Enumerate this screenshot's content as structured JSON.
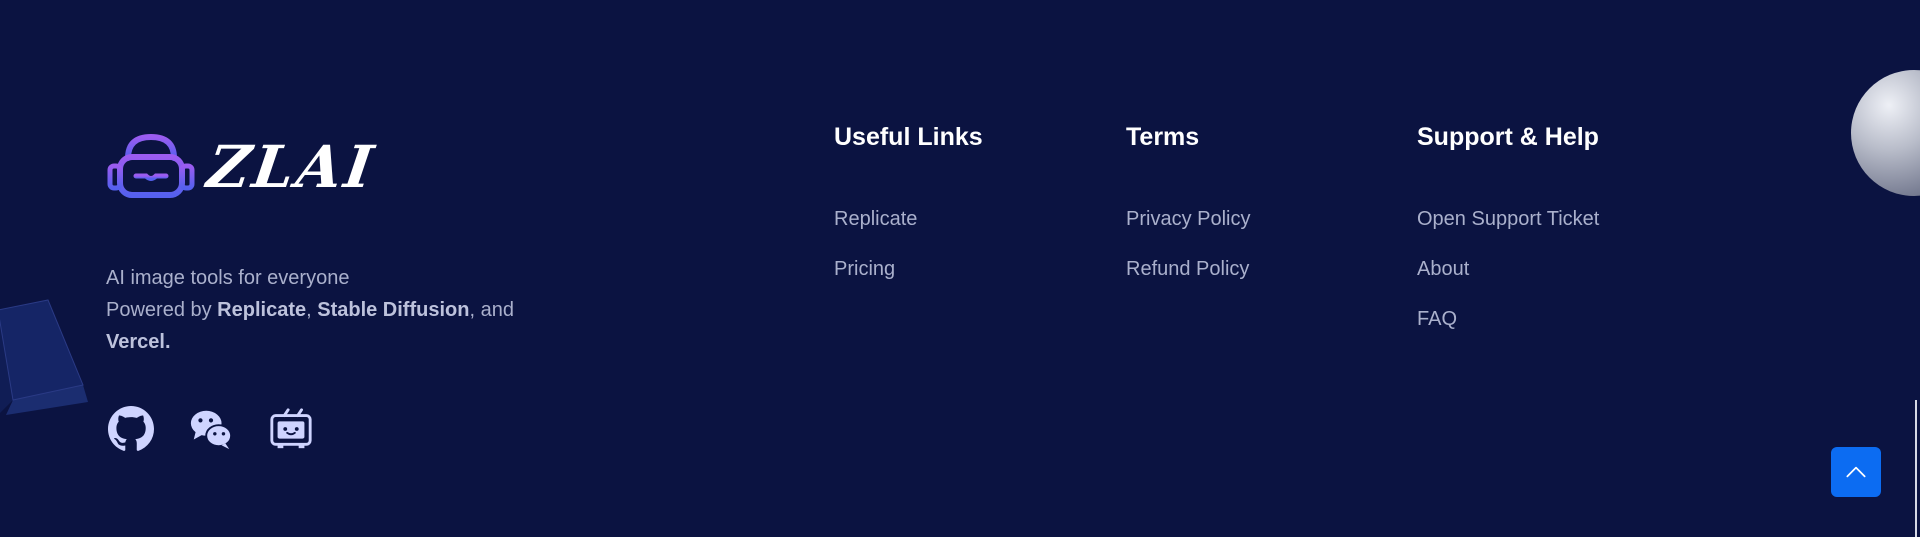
{
  "brand": {
    "name": "ZLAI",
    "tagline_line1": "AI image tools for everyone",
    "powered_prefix": "Powered by ",
    "powered_link1": "Replicate",
    "powered_sep1": ", ",
    "powered_link2": "Stable Diffusion",
    "powered_sep2": ", and ",
    "powered_link3": "Vercel."
  },
  "social": [
    {
      "icon": "github-icon"
    },
    {
      "icon": "wechat-icon"
    },
    {
      "icon": "bilibili-icon"
    }
  ],
  "columns": [
    {
      "title": "Useful Links",
      "links": [
        "Replicate",
        "Pricing"
      ]
    },
    {
      "title": "Terms",
      "links": [
        "Privacy Policy",
        "Refund Policy"
      ]
    },
    {
      "title": "Support & Help",
      "links": [
        "Open Support Ticket",
        "About",
        "FAQ"
      ]
    }
  ],
  "back_to_top": {
    "icon": "chevron-up-icon"
  },
  "colors": {
    "background": "#0b1341",
    "heading": "#ffffff",
    "link": "#aab0cc",
    "accent": "#0c6cf2",
    "logo_gradient_start": "#9b5cf0",
    "logo_gradient_end": "#5560ee"
  }
}
